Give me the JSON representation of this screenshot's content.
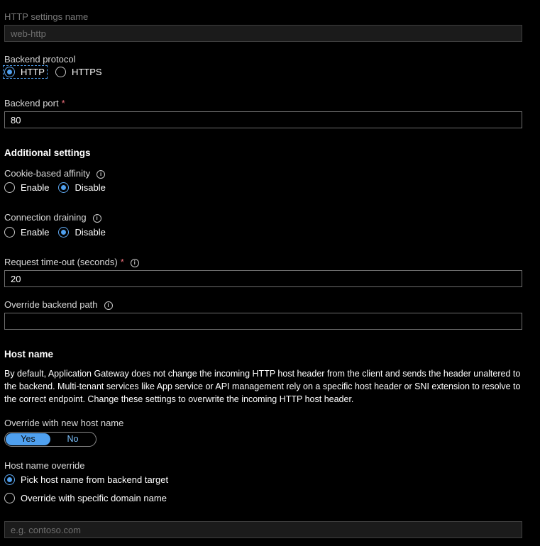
{
  "settings_name": {
    "label": "HTTP settings name",
    "value": "web-http"
  },
  "backend_protocol": {
    "label": "Backend protocol",
    "options": [
      "HTTP",
      "HTTPS"
    ],
    "selected": "HTTP"
  },
  "backend_port": {
    "label": "Backend port",
    "required_mark": "*",
    "value": "80"
  },
  "additional_settings": {
    "heading": "Additional settings"
  },
  "cookie_affinity": {
    "label": "Cookie-based affinity",
    "info": "i",
    "options": [
      "Enable",
      "Disable"
    ],
    "selected": "Disable"
  },
  "connection_draining": {
    "label": "Connection draining",
    "info": "i",
    "options": [
      "Enable",
      "Disable"
    ],
    "selected": "Disable"
  },
  "request_timeout": {
    "label": "Request time-out (seconds)",
    "required_mark": "*",
    "info": "i",
    "value": "20"
  },
  "override_path": {
    "label": "Override backend path",
    "info": "i",
    "value": ""
  },
  "host_name": {
    "heading": "Host name",
    "description": "By default, Application Gateway does not change the incoming HTTP host header from the client and sends the header unaltered to the backend. Multi-tenant services like App service or API management rely on a specific host header or SNI extension to resolve to the correct endpoint. Change these settings to overwrite the incoming HTTP host header.",
    "override_label": "Override with new host name",
    "toggle": {
      "yes": "Yes",
      "no": "No",
      "selected": "Yes"
    },
    "override_mode_label": "Host name override",
    "modes": [
      "Pick host name from backend target",
      "Override with specific domain name"
    ],
    "selected_mode": "Pick host name from backend target",
    "domain_placeholder": "e.g. contoso.com"
  },
  "colors": {
    "background": "#000000",
    "accent": "#4fa0ef",
    "required": "#f1707b"
  }
}
